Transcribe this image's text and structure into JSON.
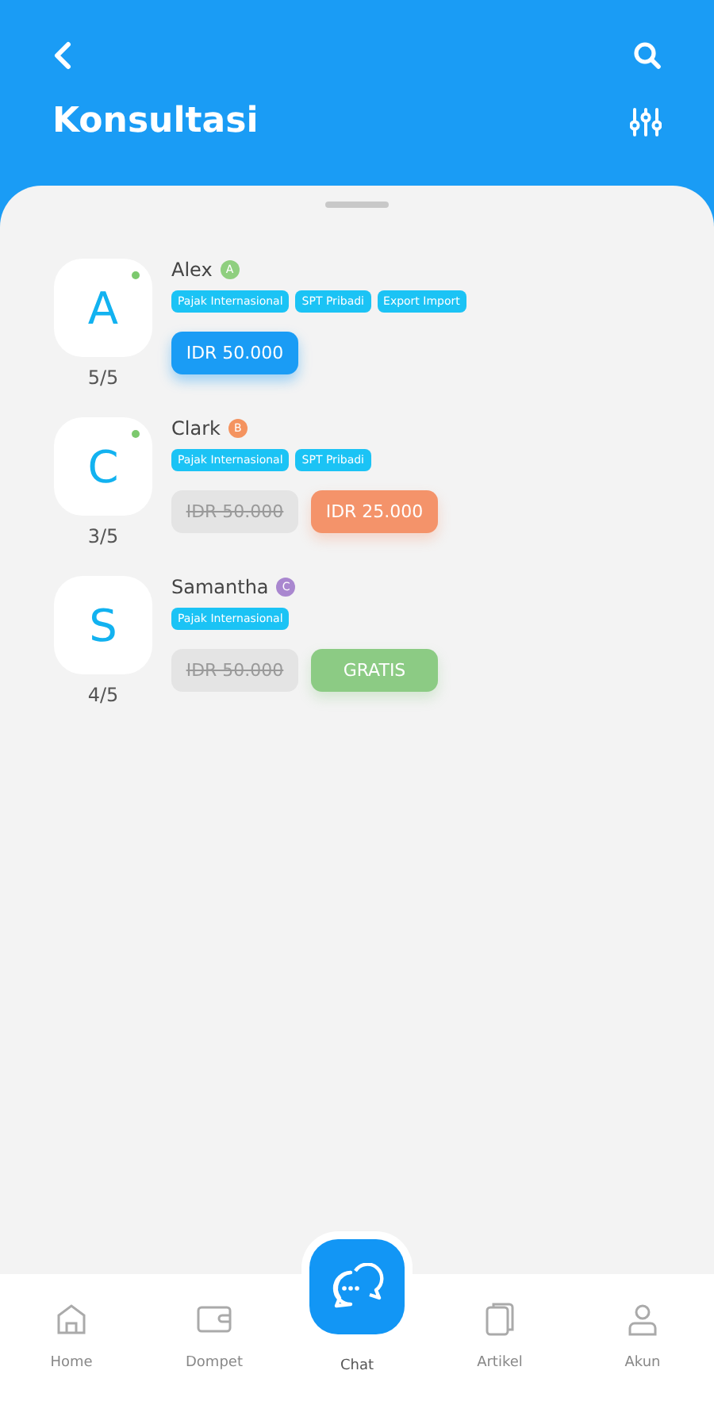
{
  "header": {
    "title": "Konsultasi"
  },
  "consultants": [
    {
      "initial": "A",
      "online": true,
      "rating": "5/5",
      "name": "Alex",
      "grade": "A",
      "color": "#8fcf7f",
      "tags": [
        "Pajak Internasional",
        "SPT Pribadi",
        "Export Import"
      ],
      "prices": [
        {
          "kind": "regular",
          "text": "IDR 50.000"
        }
      ]
    },
    {
      "initial": "C",
      "online": true,
      "rating": "3/5",
      "name": "Clark",
      "grade": "B",
      "color": "#f4935f",
      "tags": [
        "Pajak Internasional",
        "SPT Pribadi"
      ],
      "prices": [
        {
          "kind": "struck",
          "text": "IDR 50.000"
        },
        {
          "kind": "discount",
          "text": "IDR 25.000"
        }
      ]
    },
    {
      "initial": "S",
      "online": false,
      "rating": "4/5",
      "name": "Samantha",
      "grade": "C",
      "color": "#a987cf",
      "tags": [
        "Pajak Internasional"
      ],
      "prices": [
        {
          "kind": "struck",
          "text": "IDR 50.000"
        },
        {
          "kind": "free",
          "text": "GRATIS"
        }
      ]
    }
  ],
  "nav": [
    {
      "kind": "home",
      "label": "Home",
      "selected": false
    },
    {
      "kind": "wallet",
      "label": "Dompet",
      "selected": false
    },
    {
      "kind": "chat",
      "label": "Chat",
      "selected": true
    },
    {
      "kind": "article",
      "label": "Artikel",
      "selected": false
    },
    {
      "kind": "account",
      "label": "Akun",
      "selected": false
    }
  ]
}
